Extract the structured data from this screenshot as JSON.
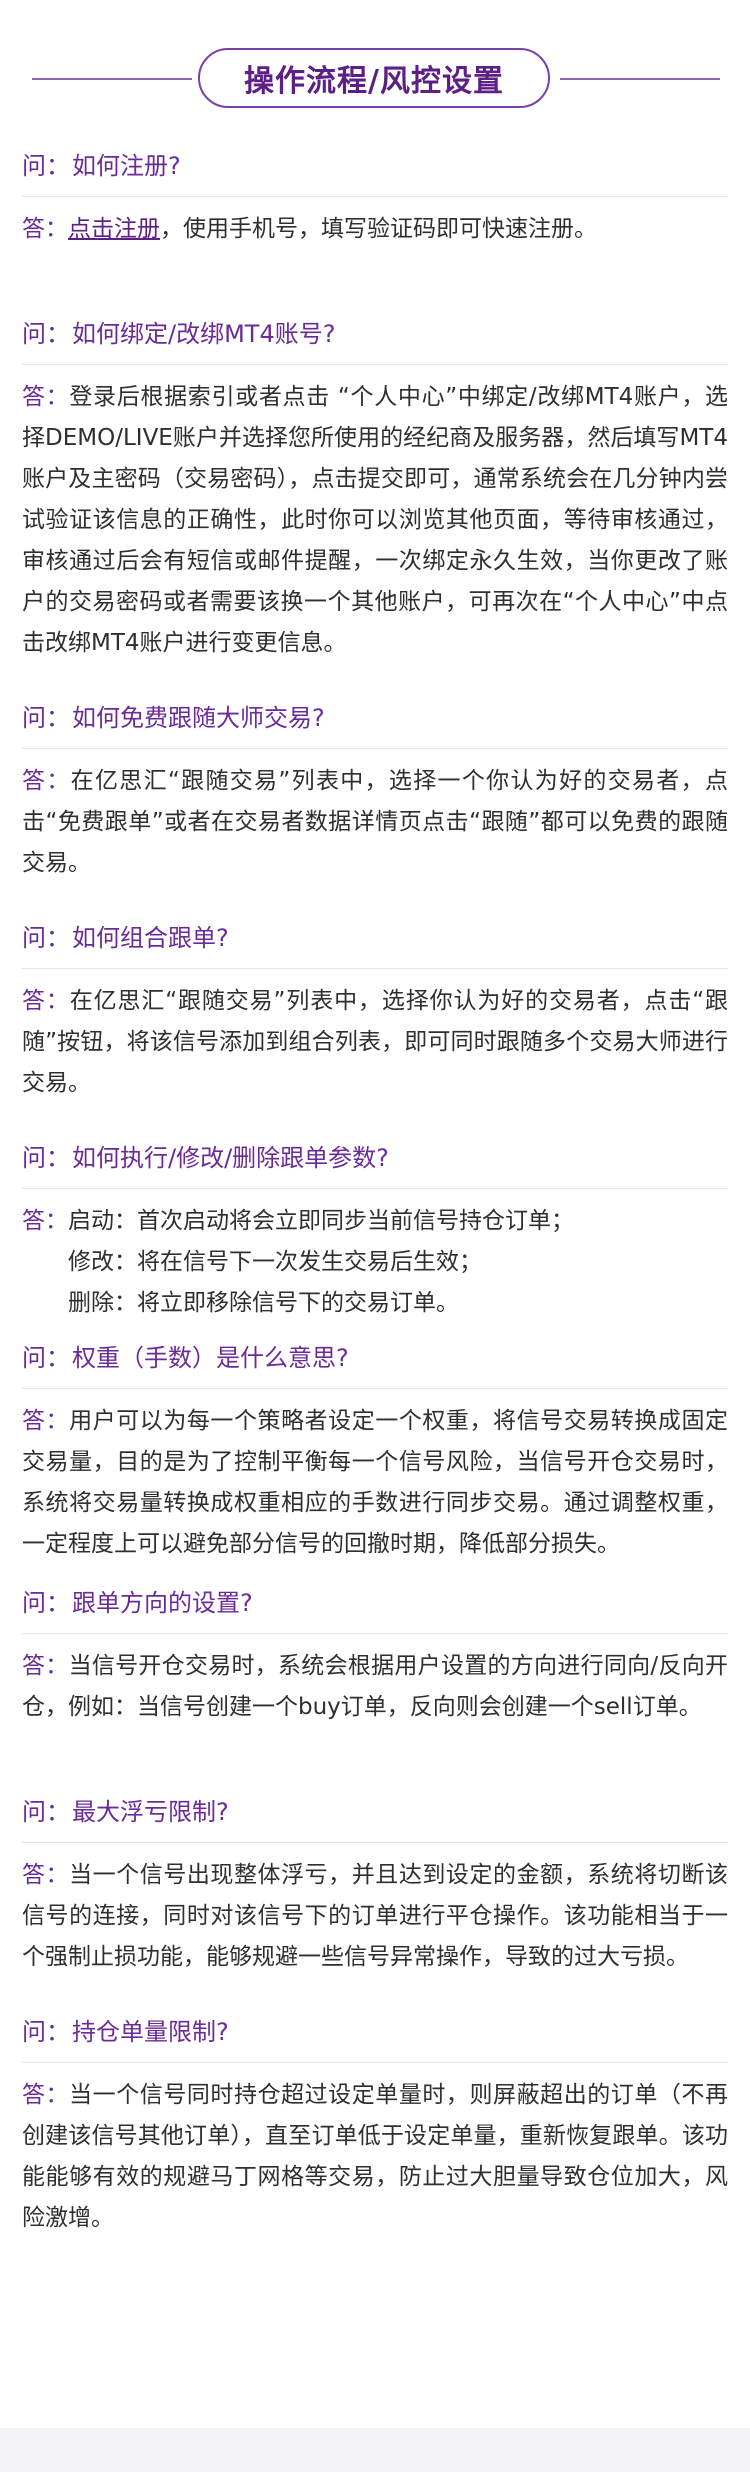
{
  "header": {
    "title": "操作流程/风控设置"
  },
  "labels": {
    "q_prefix": "问：",
    "a_prefix": "答："
  },
  "faq": [
    {
      "question": "如何注册?",
      "answer_link": "点击注册",
      "answer_rest": "，使用手机号，填写验证码即可快速注册。"
    },
    {
      "question": "如何绑定/改绑MT4账号?",
      "answer": "登录后根据索引或者点击 “个人中心”中绑定/改绑MT4账户，选择DEMO/LIVE账户并选择您所使用的经纪商及服务器，然后填写MT4账户及主密码（交易密码），点击提交即可，通常系统会在几分钟内尝试验证该信息的正确性，此时你可以浏览其他页面，等待审核通过，审核通过后会有短信或邮件提醒，一次绑定永久生效，当你更改了账户的交易密码或者需要该换一个其他账户，可再次在“个人中心”中点击改绑MT4账户进行变更信息。"
    },
    {
      "question": "如何免费跟随大师交易?",
      "answer": "在亿思汇“跟随交易”列表中，选择一个你认为好的交易者，点击“免费跟单”或者在交易者数据详情页点击“跟随”都可以免费的跟随交易。"
    },
    {
      "question": "如何组合跟单?",
      "answer": "在亿思汇“跟随交易”列表中，选择你认为好的交易者，点击“跟 随”按钮，将该信号添加到组合列表，即可同时跟随多个交易大师进行交易。"
    },
    {
      "question": "如何执行/修改/删除跟单参数?",
      "answer_lines": [
        "启动：首次启动将会立即同步当前信号持仓订单；",
        "修改：将在信号下一次发生交易后生效；",
        "删除：将立即移除信号下的交易订单。"
      ]
    },
    {
      "question": "权重（手数）是什么意思?",
      "answer": "用户可以为每一个策略者设定一个权重，将信号交易转换成固定交易量，目的是为了控制平衡每一个信号风险，当信号开仓交易时，系统将交易量转换成权重相应的手数进行同步交易。通过调整权重，一定程度上可以避免部分信号的回撤时期，降低部分损失。"
    },
    {
      "question": "跟单方向的设置?",
      "answer": "当信号开仓交易时，系统会根据用户设置的方向进行同向/反向开仓，例如：当信号创建一个buy订单，反向则会创建一个sell订单。"
    },
    {
      "question": "最大浮亏限制?",
      "answer": "当一个信号出现整体浮亏，并且达到设定的金额，系统将切断该信号的连接，同时对该信号下的订单进行平仓操作。该功能相当于一个强制止损功能，能够规避一些信号异常操作，导致的过大亏损。"
    },
    {
      "question": "持仓单量限制?",
      "answer": "当一个信号同时持仓超过设定单量时，则屏蔽超出的订单（不再创建该信号其他订单），直至订单低于设定单量，重新恢复跟单。该功能能够有效的规避马丁网格等交易，防止过大胆量导致仓位加大，风险激增。"
    }
  ]
}
